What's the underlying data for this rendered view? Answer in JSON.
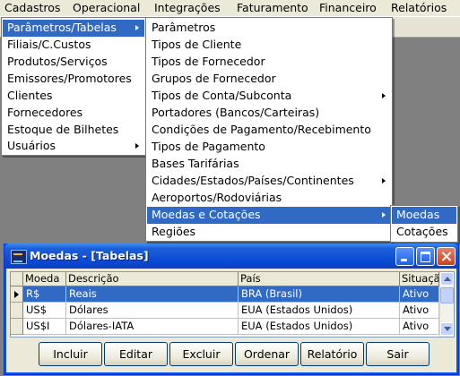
{
  "menubar": {
    "items": [
      "Cadastros",
      "Operacional",
      "Integrações",
      "Faturamento",
      "Financeiro",
      "Relatórios"
    ]
  },
  "cadastros_menu": {
    "items": [
      {
        "label": "Parâmetros/Tabelas",
        "submenu": true,
        "highlighted": true
      },
      {
        "label": "Filiais/C.Custos",
        "submenu": false
      },
      {
        "label": "Produtos/Serviços",
        "submenu": false
      },
      {
        "label": "Emissores/Promotores",
        "submenu": false
      },
      {
        "label": "Clientes",
        "submenu": false
      },
      {
        "label": "Fornecedores",
        "submenu": false
      },
      {
        "label": "Estoque de Bilhetes",
        "submenu": false
      },
      {
        "label": "Usuários",
        "submenu": true
      }
    ]
  },
  "parametros_menu": {
    "items": [
      {
        "label": "Parâmetros",
        "submenu": false
      },
      {
        "label": "Tipos de Cliente",
        "submenu": false
      },
      {
        "label": "Tipos de Fornecedor",
        "submenu": false
      },
      {
        "label": "Grupos de Fornecedor",
        "submenu": false
      },
      {
        "label": "Tipos de Conta/Subconta",
        "submenu": true
      },
      {
        "label": "Portadores (Bancos/Carteiras)",
        "submenu": false
      },
      {
        "label": "Condições de Pagamento/Recebimento",
        "submenu": false
      },
      {
        "label": "Tipos de Pagamento",
        "submenu": false
      },
      {
        "label": "Bases Tarifárias",
        "submenu": false
      },
      {
        "label": "Cidades/Estados/Países/Continentes",
        "submenu": true
      },
      {
        "label": "Aeroportos/Rodoviárias",
        "submenu": false
      },
      {
        "label": "Moedas e Cotações",
        "submenu": true,
        "highlighted": true
      },
      {
        "label": "Regiões",
        "submenu": false
      }
    ]
  },
  "moedas_menu": {
    "items": [
      {
        "label": "Moedas",
        "highlighted": true
      },
      {
        "label": "Cotações"
      }
    ]
  },
  "window": {
    "title": "Moedas - [Tabelas]",
    "columns": [
      "Moeda",
      "Descrição",
      "País",
      "Situação"
    ],
    "rows": [
      {
        "moeda": "R$",
        "descricao": "Reais",
        "pais": "BRA (Brasil)",
        "situacao": "Ativo",
        "selected": true
      },
      {
        "moeda": "US$",
        "descricao": "Dólares",
        "pais": "EUA (Estados Unidos)",
        "situacao": "Ativo"
      },
      {
        "moeda": "US$I",
        "descricao": "Dólares-IATA",
        "pais": "EUA (Estados Unidos)",
        "situacao": "Ativo"
      }
    ],
    "buttons": {
      "incluir": "Incluir",
      "editar": "Editar",
      "excluir": "Excluir",
      "ordenar": "Ordenar",
      "relatorio": "Relatório",
      "sair": "Sair"
    }
  },
  "colors": {
    "highlight": "#316ac5",
    "titlebar": "#0a4ad6",
    "window_face": "#ece9d8"
  }
}
